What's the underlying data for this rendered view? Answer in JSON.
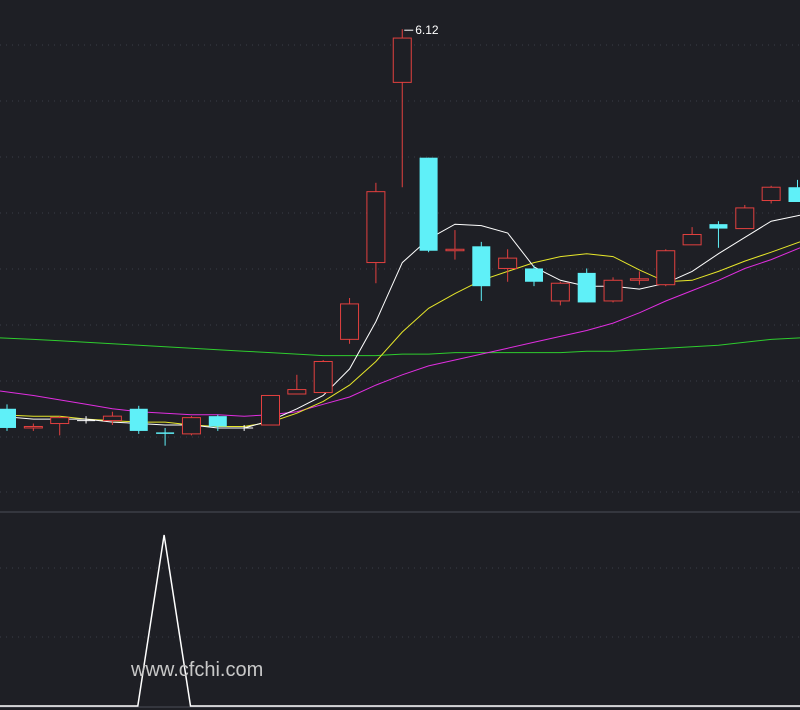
{
  "chart_data": {
    "type": "candlestick",
    "colors": {
      "background": "#1e1f25",
      "grid": "#3a3d48",
      "divider": "#4a4d58",
      "up": "#e2403f",
      "down": "#5ff0f8",
      "cross": "#ffffff",
      "ma_short": "#ffffff",
      "ma_mid": "#e6e62a",
      "ma_long": "#e02ee0",
      "ma_trend": "#2ecc2e",
      "indicator": "#ffffff",
      "label": "#ffffff",
      "watermark": "#c8c8c8"
    },
    "ylim": [
      3.0,
      6.25
    ],
    "candles": [
      {
        "o": 3.55,
        "h": 3.58,
        "l": 3.4,
        "c": 3.42
      },
      {
        "o": 3.42,
        "h": 3.45,
        "l": 3.4,
        "c": 3.43
      },
      {
        "o": 3.45,
        "h": 3.5,
        "l": 3.37,
        "c": 3.49
      },
      {
        "o": 3.47,
        "h": 3.5,
        "l": 3.45,
        "c": 3.47
      },
      {
        "o": 3.47,
        "h": 3.53,
        "l": 3.44,
        "c": 3.5
      },
      {
        "o": 3.55,
        "h": 3.57,
        "l": 3.38,
        "c": 3.4
      },
      {
        "o": 3.39,
        "h": 3.42,
        "l": 3.3,
        "c": 3.38
      },
      {
        "o": 3.38,
        "h": 3.5,
        "l": 3.37,
        "c": 3.49
      },
      {
        "o": 3.5,
        "h": 3.51,
        "l": 3.4,
        "c": 3.43
      },
      {
        "o": 3.42,
        "h": 3.44,
        "l": 3.4,
        "c": 3.42
      },
      {
        "o": 3.44,
        "h": 3.64,
        "l": 3.44,
        "c": 3.64
      },
      {
        "o": 3.65,
        "h": 3.78,
        "l": 3.65,
        "c": 3.68
      },
      {
        "o": 3.66,
        "h": 3.88,
        "l": 3.66,
        "c": 3.87
      },
      {
        "o": 4.02,
        "h": 4.3,
        "l": 3.99,
        "c": 4.26
      },
      {
        "o": 4.54,
        "h": 5.08,
        "l": 4.4,
        "c": 5.02
      },
      {
        "o": 5.76,
        "h": 6.12,
        "l": 5.05,
        "c": 6.06
      },
      {
        "o": 5.25,
        "h": 5.25,
        "l": 4.61,
        "c": 4.62
      },
      {
        "o": 4.62,
        "h": 4.76,
        "l": 4.56,
        "c": 4.63
      },
      {
        "o": 4.65,
        "h": 4.68,
        "l": 4.28,
        "c": 4.38
      },
      {
        "o": 4.5,
        "h": 4.63,
        "l": 4.41,
        "c": 4.57
      },
      {
        "o": 4.5,
        "h": 4.52,
        "l": 4.38,
        "c": 4.41
      },
      {
        "o": 4.28,
        "h": 4.41,
        "l": 4.25,
        "c": 4.4
      },
      {
        "o": 4.47,
        "h": 4.5,
        "l": 4.27,
        "c": 4.27
      },
      {
        "o": 4.28,
        "h": 4.44,
        "l": 4.27,
        "c": 4.42
      },
      {
        "o": 4.42,
        "h": 4.48,
        "l": 4.39,
        "c": 4.43
      },
      {
        "o": 4.39,
        "h": 4.63,
        "l": 4.38,
        "c": 4.62
      },
      {
        "o": 4.66,
        "h": 4.78,
        "l": 4.66,
        "c": 4.73
      },
      {
        "o": 4.8,
        "h": 4.82,
        "l": 4.64,
        "c": 4.77
      },
      {
        "o": 4.77,
        "h": 4.93,
        "l": 4.77,
        "c": 4.91
      },
      {
        "o": 4.96,
        "h": 5.06,
        "l": 4.94,
        "c": 5.05
      },
      {
        "o": 5.05,
        "h": 5.1,
        "l": 4.95,
        "c": 4.95
      }
    ],
    "ma": [
      {
        "key": "ma_trend",
        "values": [
          4.03,
          4.02,
          4.01,
          4.0,
          3.99,
          3.98,
          3.97,
          3.96,
          3.95,
          3.94,
          3.93,
          3.92,
          3.91,
          3.91,
          3.91,
          3.92,
          3.92,
          3.93,
          3.93,
          3.93,
          3.93,
          3.93,
          3.94,
          3.94,
          3.95,
          3.96,
          3.97,
          3.98,
          4.0,
          4.02,
          4.03
        ]
      },
      {
        "key": "ma_long",
        "values": [
          3.67,
          3.64,
          3.61,
          3.58,
          3.55,
          3.53,
          3.52,
          3.51,
          3.51,
          3.5,
          3.51,
          3.53,
          3.58,
          3.63,
          3.71,
          3.78,
          3.84,
          3.88,
          3.92,
          3.96,
          4.0,
          4.04,
          4.08,
          4.13,
          4.2,
          4.28,
          4.35,
          4.42,
          4.5,
          4.56,
          4.64
        ]
      },
      {
        "key": "ma_mid",
        "values": [
          3.51,
          3.5,
          3.5,
          3.48,
          3.47,
          3.46,
          3.46,
          3.44,
          3.43,
          3.43,
          3.46,
          3.52,
          3.6,
          3.71,
          3.87,
          4.07,
          4.23,
          4.33,
          4.42,
          4.48,
          4.54,
          4.58,
          4.6,
          4.58,
          4.49,
          4.41,
          4.42,
          4.48,
          4.55,
          4.61,
          4.68
        ]
      },
      {
        "key": "ma_short",
        "values": [
          3.5,
          3.48,
          3.48,
          3.48,
          3.46,
          3.45,
          3.44,
          3.44,
          3.42,
          3.42,
          3.47,
          3.55,
          3.64,
          3.82,
          4.14,
          4.54,
          4.7,
          4.8,
          4.79,
          4.74,
          4.51,
          4.42,
          4.38,
          4.38,
          4.36,
          4.4,
          4.48,
          4.6,
          4.71,
          4.82,
          4.86
        ]
      }
    ],
    "peak": {
      "index": 15,
      "label": "6.12"
    },
    "indicator": {
      "ylim": [
        0,
        1
      ],
      "values": [
        0,
        0,
        0,
        0,
        0,
        0,
        1,
        0,
        0,
        0,
        0,
        0,
        0,
        0,
        0,
        0,
        0,
        0,
        0,
        0,
        0,
        0,
        0,
        0,
        0,
        0,
        0,
        0,
        0,
        0,
        0
      ]
    }
  },
  "watermark": "www.cfchi.com"
}
